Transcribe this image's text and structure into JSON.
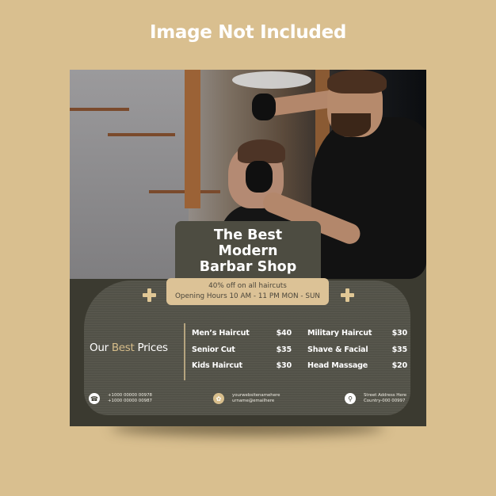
{
  "page_title": "Image Not Included",
  "flyer": {
    "photo_alt": "barber cutting client's hair",
    "headline": [
      "The Best",
      "Modern",
      "Barbar Shop"
    ],
    "offer": {
      "line1": "40% off on all haircuts",
      "line2": "Opening Hours 10 AM - 11 PM MON - SUN"
    },
    "decor_icon": "plus-icon",
    "prices_title": {
      "part1": "Our ",
      "accent": "Best",
      "part2": " Prices"
    },
    "prices_left": [
      {
        "name": "Men’s Haircut",
        "price": "$40"
      },
      {
        "name": "Senior Cut",
        "price": "$35"
      },
      {
        "name": "Kids Haircut",
        "price": "$30"
      }
    ],
    "prices_right": [
      {
        "name": "Military Haircut",
        "price": "$30"
      },
      {
        "name": "Shave & Facial",
        "price": "$35"
      },
      {
        "name": "Head Massage",
        "price": "$20"
      }
    ],
    "footer": {
      "phone": {
        "icon": "phone-icon",
        "glyph": "☎",
        "line1": "+1000 00000 00978",
        "line2": "+1000 00000 00987"
      },
      "web": {
        "icon": "globe-icon",
        "glyph": "✿",
        "line1": "yourwebsitenamehere",
        "line2": "urname@emailhere"
      },
      "address": {
        "icon": "location-pin-icon",
        "glyph": "⚲",
        "line1": "Street Address Here",
        "line2": "Country-000 00997"
      }
    },
    "colors": {
      "background": "#d9bf8f",
      "card": "#3b3a30",
      "panel": "#55544a",
      "accent": "#d6bd8a",
      "offer_box": "#dcc296"
    }
  }
}
